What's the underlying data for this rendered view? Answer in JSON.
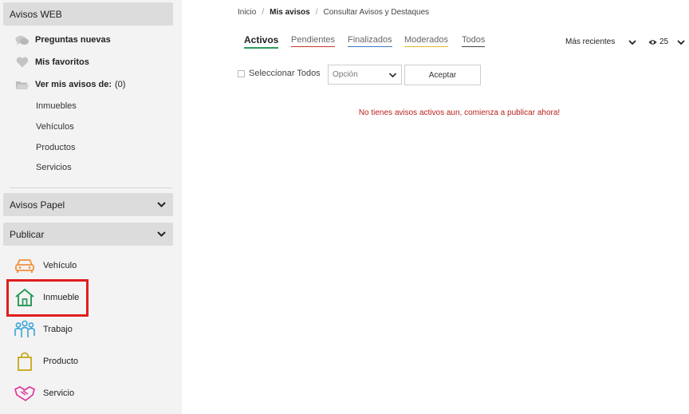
{
  "sidebar": {
    "avisos_web": {
      "title": "Avisos WEB",
      "items": [
        {
          "label": "Preguntas nuevas",
          "icon": "chat-bubbles-icon"
        },
        {
          "label": "Mis favoritos",
          "icon": "heart-icon"
        },
        {
          "label": "Ver mis avisos de:",
          "count": "(0)",
          "icon": "folder-icon"
        }
      ],
      "sub_items": [
        "Inmuebles",
        "Vehículos",
        "Productos",
        "Servicios"
      ]
    },
    "avisos_papel": {
      "title": "Avisos Papel"
    },
    "publicar": {
      "title": "Publicar",
      "items": [
        {
          "label": "Vehículo",
          "icon": "car-icon",
          "color": "#f0913b"
        },
        {
          "label": "Inmueble",
          "icon": "house-icon",
          "color": "#2e9b5a"
        },
        {
          "label": "Trabajo",
          "icon": "people-icon",
          "color": "#3aa6d8"
        },
        {
          "label": "Producto",
          "icon": "shopping-bag-icon",
          "color": "#c8a616"
        },
        {
          "label": "Servicio",
          "icon": "handshake-icon",
          "color": "#e0389a"
        }
      ]
    }
  },
  "breadcrumb": {
    "items": [
      "Inicio",
      "Mis avisos",
      "Consultar Avisos y Destaques"
    ]
  },
  "tabs": [
    {
      "label": "Activos",
      "underline": "#2e9b5a"
    },
    {
      "label": "Pendientes",
      "underline": "#c0392b"
    },
    {
      "label": "Finalizados",
      "underline": "#3a78c8"
    },
    {
      "label": "Moderados",
      "underline": "#e6b82e"
    },
    {
      "label": "Todos",
      "underline": "#444444"
    }
  ],
  "sort": {
    "label": "Más recientes"
  },
  "views": {
    "count": "25"
  },
  "bulk": {
    "select_all_label": "Seleccionar Todos",
    "option_placeholder": "Opción",
    "accept_label": "Aceptar"
  },
  "empty_message": "No tienes avisos activos aun, comienza a publicar ahora!",
  "colors": {
    "error_text": "#b8211d",
    "highlight": "#e01e1e"
  }
}
